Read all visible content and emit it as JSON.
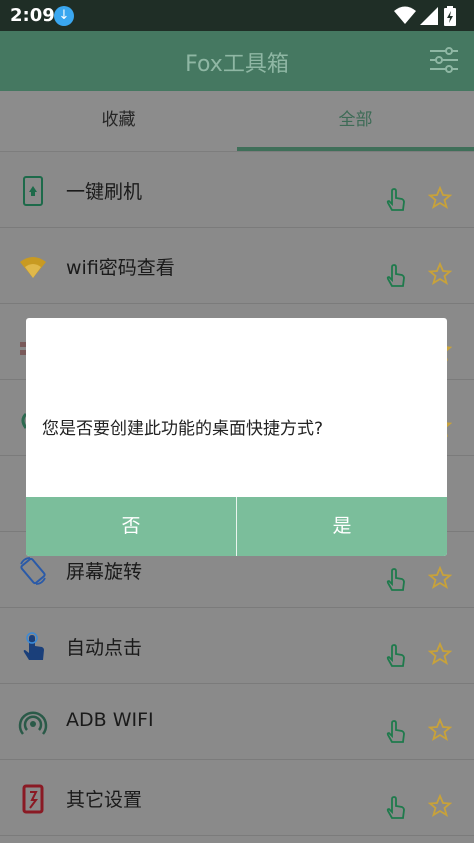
{
  "status": {
    "time": "2:09"
  },
  "appbar": {
    "title": "Fox工具箱"
  },
  "tabs": [
    {
      "label": "收藏",
      "selected": false
    },
    {
      "label": "全部",
      "selected": true
    }
  ],
  "items": [
    {
      "label": "一键刷机",
      "icon": "phone-icon"
    },
    {
      "label": "wifi密码查看",
      "icon": "wifi-icon"
    },
    {
      "label": "",
      "icon": "grid-icon"
    },
    {
      "label": "",
      "icon": "circle-icon"
    },
    {
      "label": "",
      "icon": ""
    },
    {
      "label": "屏幕旋转",
      "icon": "rotate-icon"
    },
    {
      "label": "自动点击",
      "icon": "tap-icon"
    },
    {
      "label": "ADB WIFI",
      "icon": "adb-wifi-icon"
    },
    {
      "label": "其它设置",
      "icon": "settings-card-icon"
    }
  ],
  "dialog": {
    "message": "您是否要创建此功能的桌面快捷方式?",
    "no_label": "否",
    "yes_label": "是"
  },
  "colors": {
    "appbar": "#457861",
    "accent": "#3f6f59",
    "dialog_button": "#7bbe9b",
    "star": "#c8a23a"
  }
}
